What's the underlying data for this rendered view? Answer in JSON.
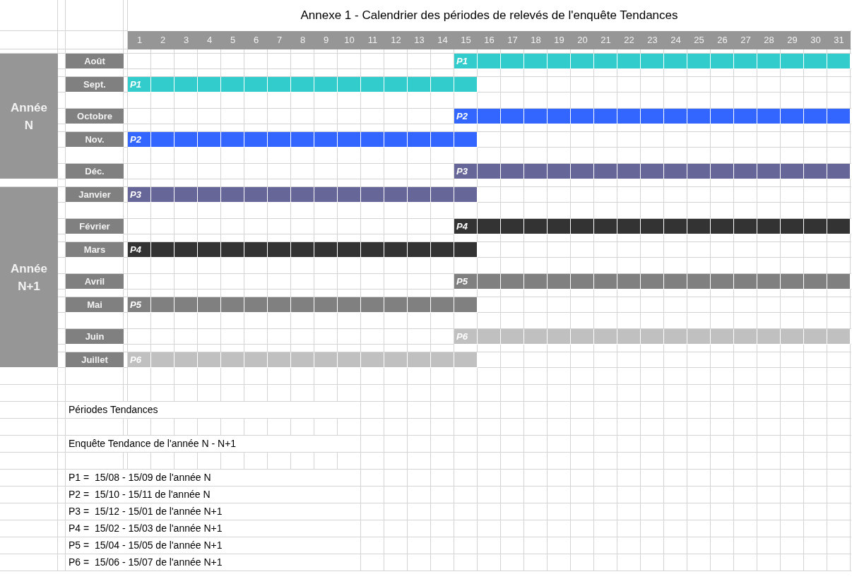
{
  "title": "Annexe 1 - Calendrier des périodes de relevés de l'enquête Tendances",
  "days": [
    "1",
    "2",
    "3",
    "4",
    "5",
    "6",
    "7",
    "8",
    "9",
    "10",
    "11",
    "12",
    "13",
    "14",
    "15",
    "16",
    "17",
    "18",
    "19",
    "20",
    "21",
    "22",
    "23",
    "24",
    "25",
    "26",
    "27",
    "28",
    "29",
    "30",
    "31"
  ],
  "years": [
    {
      "label": "Année\nN",
      "months": [
        {
          "name": "Août",
          "bar": {
            "label": "P1",
            "kind": "second-half",
            "color": "#33cccc"
          }
        },
        {
          "name": "Sept.",
          "bar": {
            "label": "P1",
            "kind": "first-half",
            "color": "#33cccc"
          }
        },
        {
          "name": "Octobre",
          "bar": {
            "label": "P2",
            "kind": "second-half",
            "color": "#3366ff"
          }
        },
        {
          "name": "Nov.",
          "bar": {
            "label": "P2",
            "kind": "first-half",
            "color": "#3366ff"
          }
        },
        {
          "name": "Déc.",
          "bar": {
            "label": "P3",
            "kind": "second-half",
            "color": "#666699"
          }
        }
      ]
    },
    {
      "label": "Année\nN+1",
      "months": [
        {
          "name": "Janvier",
          "bar": {
            "label": "P3",
            "kind": "first-half",
            "color": "#666699"
          }
        },
        {
          "name": "Février",
          "bar": {
            "label": "P4",
            "kind": "second-half",
            "color": "#333333"
          }
        },
        {
          "name": "Mars",
          "bar": {
            "label": "P4",
            "kind": "first-half",
            "color": "#333333"
          }
        },
        {
          "name": "Avril",
          "bar": {
            "label": "P5",
            "kind": "second-half",
            "color": "#808080"
          }
        },
        {
          "name": "Mai",
          "bar": {
            "label": "P5",
            "kind": "first-half",
            "color": "#808080"
          }
        },
        {
          "name": "Juin",
          "bar": {
            "label": "P6",
            "kind": "second-half",
            "color": "#c0c0c0"
          }
        },
        {
          "name": "Juillet",
          "bar": {
            "label": "P6",
            "kind": "first-half",
            "color": "#c0c0c0"
          }
        }
      ]
    }
  ],
  "legend": {
    "heading": "Périodes Tendances",
    "subtitle": "Enquête Tendance de l'année N - N+1",
    "periods": [
      "P1 =  15/08 - 15/09 de l'année N",
      "P2 =  15/10 - 15/11 de l'année N",
      "P3 =  15/12 - 15/01 de l'année N+1",
      "P4 =  15/02 - 15/03 de l'année N+1",
      "P5 =  15/04 - 15/05 de l'année N+1",
      "P6 =  15/06 - 15/07 de l'année N+1"
    ]
  }
}
